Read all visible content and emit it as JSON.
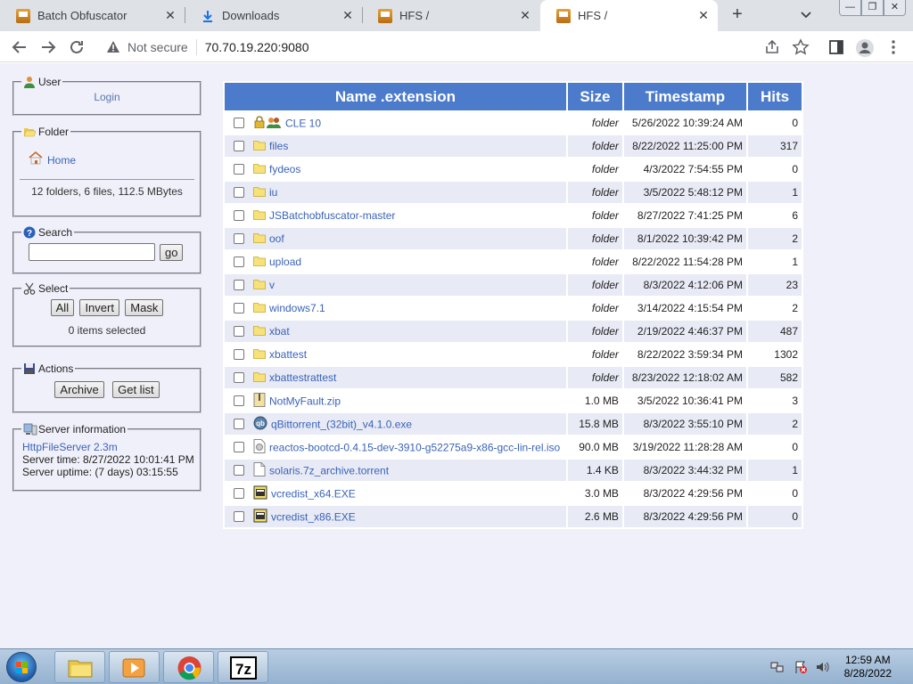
{
  "browser": {
    "tabs": [
      {
        "title": "Batch Obfuscator",
        "icon": "hfs-icon",
        "active": false
      },
      {
        "title": "Downloads",
        "icon": "download-icon",
        "active": false
      },
      {
        "title": "HFS /",
        "icon": "hfs-icon",
        "active": false
      },
      {
        "title": "HFS /",
        "icon": "hfs-icon",
        "active": true
      }
    ],
    "new_tab": "+",
    "security": "Not secure",
    "url": "70.70.19.220:9080"
  },
  "sidebar": {
    "user": {
      "legend": "User",
      "login": "Login"
    },
    "folder": {
      "legend": "Folder",
      "home": "Home",
      "summary": "12 folders, 6 files, 112.5 MBytes"
    },
    "search": {
      "legend": "Search",
      "go": "go",
      "value": ""
    },
    "select": {
      "legend": "Select",
      "all": "All",
      "invert": "Invert",
      "mask": "Mask",
      "status": "0 items selected"
    },
    "actions": {
      "legend": "Actions",
      "archive": "Archive",
      "getlist": "Get list"
    },
    "server": {
      "legend": "Server information",
      "name": "HttpFileServer 2.3m",
      "time": "Server time: 8/27/2022 10:01:41 PM",
      "uptime": "Server uptime: (7 days) 03:15:55"
    }
  },
  "table": {
    "headers": {
      "name": "Name .extension",
      "size": "Size",
      "timestamp": "Timestamp",
      "hits": "Hits"
    },
    "rows": [
      {
        "name": "CLE 10",
        "size": "folder",
        "timestamp": "5/26/2022 10:39:24 AM",
        "hits": "0",
        "type": "locked-folder"
      },
      {
        "name": "files",
        "size": "folder",
        "timestamp": "8/22/2022 11:25:00 PM",
        "hits": "317",
        "type": "folder"
      },
      {
        "name": "fydeos",
        "size": "folder",
        "timestamp": "4/3/2022 7:54:55 PM",
        "hits": "0",
        "type": "folder"
      },
      {
        "name": "iu",
        "size": "folder",
        "timestamp": "3/5/2022 5:48:12 PM",
        "hits": "1",
        "type": "folder"
      },
      {
        "name": "JSBatchobfuscator-master",
        "size": "folder",
        "timestamp": "8/27/2022 7:41:25 PM",
        "hits": "6",
        "type": "folder"
      },
      {
        "name": "oof",
        "size": "folder",
        "timestamp": "8/1/2022 10:39:42 PM",
        "hits": "2",
        "type": "folder"
      },
      {
        "name": "upload",
        "size": "folder",
        "timestamp": "8/22/2022 11:54:28 PM",
        "hits": "1",
        "type": "folder"
      },
      {
        "name": "v",
        "size": "folder",
        "timestamp": "8/3/2022 4:12:06 PM",
        "hits": "23",
        "type": "folder"
      },
      {
        "name": "windows7.1",
        "size": "folder",
        "timestamp": "3/14/2022 4:15:54 PM",
        "hits": "2",
        "type": "folder"
      },
      {
        "name": "xbat",
        "size": "folder",
        "timestamp": "2/19/2022 4:46:37 PM",
        "hits": "487",
        "type": "folder"
      },
      {
        "name": "xbattest",
        "size": "folder",
        "timestamp": "8/22/2022 3:59:34 PM",
        "hits": "1302",
        "type": "folder"
      },
      {
        "name": "xbattestrattest",
        "size": "folder",
        "timestamp": "8/23/2022 12:18:02 AM",
        "hits": "582",
        "type": "folder"
      },
      {
        "name": "NotMyFault.zip",
        "size": "1.0 MB",
        "timestamp": "3/5/2022 10:36:41 PM",
        "hits": "3",
        "type": "zip"
      },
      {
        "name": "qBittorrent_(32bit)_v4.1.0.exe",
        "size": "15.8 MB",
        "timestamp": "8/3/2022 3:55:10 PM",
        "hits": "2",
        "type": "exe-qb"
      },
      {
        "name": "reactos-bootcd-0.4.15-dev-3910-g52275a9-x86-gcc-lin-rel.iso",
        "size": "90.0 MB",
        "timestamp": "3/19/2022 11:28:28 AM",
        "hits": "0",
        "type": "iso"
      },
      {
        "name": "solaris.7z_archive.torrent",
        "size": "1.4 KB",
        "timestamp": "8/3/2022 3:44:32 PM",
        "hits": "1",
        "type": "file"
      },
      {
        "name": "vcredist_x64.EXE",
        "size": "3.0 MB",
        "timestamp": "8/3/2022 4:29:56 PM",
        "hits": "0",
        "type": "exe"
      },
      {
        "name": "vcredist_x86.EXE",
        "size": "2.6 MB",
        "timestamp": "8/3/2022 4:29:56 PM",
        "hits": "0",
        "type": "exe"
      }
    ]
  },
  "taskbar": {
    "apps": [
      "explorer-icon",
      "media-player-icon",
      "chrome-icon",
      "7zip-icon"
    ],
    "time": "12:59 AM",
    "date": "8/28/2022"
  },
  "colors": {
    "header_blue": "#4c7bcc",
    "page_bg": "#f0f0fa",
    "link": "#3a63b8"
  }
}
